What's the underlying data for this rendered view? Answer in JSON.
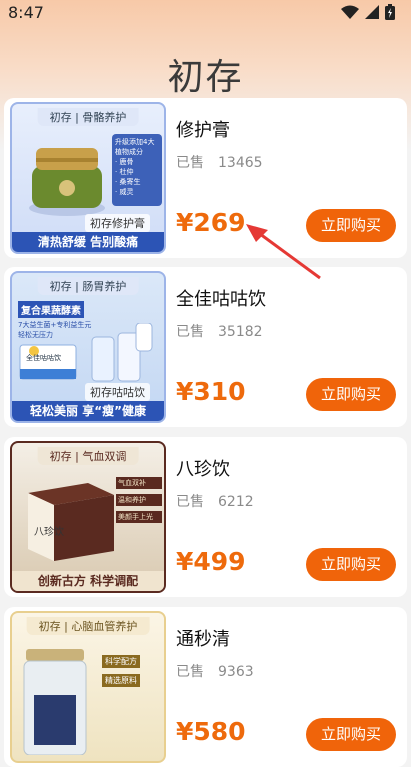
{
  "status_bar": {
    "time": "8:47"
  },
  "page": {
    "title": "初存"
  },
  "products": [
    {
      "name": "修护膏",
      "sold_label": "已售",
      "sold_count": "13465",
      "price": "¥269",
      "buy_label": "立即购买",
      "thumb": {
        "header": "初存 | 骨骼养护",
        "caption": "初存修护膏",
        "footer": "清热舒缓 告别酸痛",
        "side_text": "升级添加4大植物成分",
        "bullets": [
          "· 鹿骨",
          "· 杜仲",
          "· 桑寄生",
          "· 威灵"
        ]
      }
    },
    {
      "name": "全佳咕咕饮",
      "sold_label": "已售",
      "sold_count": "35182",
      "price": "¥310",
      "buy_label": "立即购买",
      "thumb": {
        "header": "初存 | 肠胃养护",
        "caption": "初存咕咕饮",
        "footer": "轻松美丽 享“瘦”健康",
        "banner_title": "复合果蔬酵素",
        "banner_lines": [
          "7大益生菌+专利益生元",
          "轻松无压力"
        ],
        "box_label": "全佳咕咕饮"
      }
    },
    {
      "name": "八珍饮",
      "sold_label": "已售",
      "sold_count": "6212",
      "price": "¥499",
      "buy_label": "立即购买",
      "thumb": {
        "header": "初存 | 气血双调",
        "footer": "创新古方 科学调配",
        "tags": [
          "气血双补",
          "温和养护",
          "美颜手上光"
        ],
        "box_label": "八珍饮"
      }
    },
    {
      "name": "通秒清",
      "sold_label": "已售",
      "sold_count": "9363",
      "price": "¥580",
      "buy_label": "立即购买",
      "thumb": {
        "header": "初存 | 心脑血管养护",
        "tags": [
          "科学配方",
          "精选原料"
        ]
      }
    }
  ],
  "colors": {
    "accent": "#ee6a0c",
    "button": "#f0640a",
    "arrow": "#e53935"
  }
}
